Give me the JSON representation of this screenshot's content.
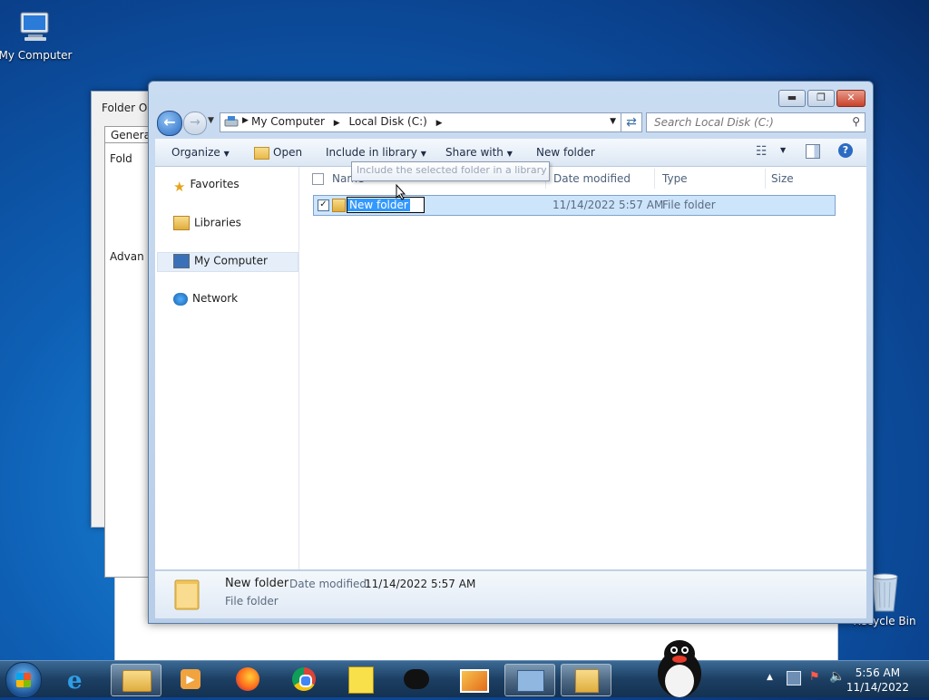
{
  "desktop": {
    "icons": [
      {
        "label": "My Computer"
      },
      {
        "label": "Recycle Bin"
      }
    ]
  },
  "folder_options": {
    "title": "Folder Op",
    "tab": "General",
    "section1": "Fold",
    "section2": "Advan"
  },
  "explorer": {
    "breadcrumbs": [
      "My Computer",
      "Local Disk (C:)"
    ],
    "search_placeholder": "Search Local Disk (C:)",
    "toolbar": {
      "organize": "Organize",
      "open": "Open",
      "include": "Include in library",
      "share": "Share with",
      "new_folder": "New folder"
    },
    "nav": {
      "favorites": "Favorites",
      "libraries": "Libraries",
      "computer": "My Computer",
      "network": "Network"
    },
    "columns": {
      "name": "Name",
      "date": "Date modified",
      "type": "Type",
      "size": "Size"
    },
    "tooltip": "Include the selected folder in a library",
    "rows": [
      {
        "name": "New folder",
        "date": "11/14/2022 5:57 AM",
        "type": "File folder"
      }
    ],
    "details": {
      "name": "New folder",
      "date_label": "Date modified:",
      "date_value": "11/14/2022 5:57 AM",
      "type": "File folder"
    }
  },
  "taskbar": {
    "time": "5:56 AM",
    "date": "11/14/2022"
  }
}
